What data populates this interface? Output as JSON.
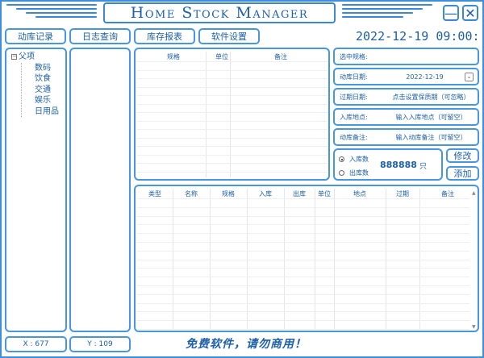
{
  "app": {
    "title": "Home Stock Manager",
    "minimize_glyph": "—",
    "close_glyph": "✕"
  },
  "toolbar": {
    "record_label": "动库记录",
    "log_label": "日志查询",
    "report_label": "库存报表",
    "settings_label": "软件设置"
  },
  "clock": "2022-12-19 09:00:",
  "category_tree": {
    "root": "父项",
    "root_toggle": "⊟",
    "items": [
      "数码",
      "饮食",
      "交通",
      "娱乐",
      "日用品"
    ]
  },
  "spec_table": {
    "columns": [
      "规格",
      "单位",
      "备注"
    ]
  },
  "form": {
    "spec_label": "选中规格:",
    "date_label": "动库日期:",
    "date_value": "2022-12-19",
    "date_dropdown_glyph": "⌄",
    "expiry_label": "过期日期:",
    "expiry_placeholder": "点击设置保质期（可忽略）",
    "location_label": "入库地点:",
    "location_placeholder": "输入入库地点（可留空）",
    "note_label": "动库备注:",
    "note_placeholder": "输入动库备注（可留空）"
  },
  "quantity": {
    "in_label": "入库数",
    "out_label": "出库数",
    "selected": "in",
    "value": "888888",
    "unit": "只"
  },
  "actions": {
    "modify_label": "修改",
    "add_label": "添加"
  },
  "record_table": {
    "columns": [
      "类型",
      "名称",
      "规格",
      "入库",
      "出库",
      "单位",
      "地点",
      "过期",
      "备注"
    ]
  },
  "status": {
    "x_label": "X : 677",
    "y_label": "Y : 109"
  },
  "footer": {
    "slogan": "免费软件，请勿商用！"
  },
  "colors": {
    "accent": "#3e8fdb",
    "text": "#1d5fa8"
  }
}
